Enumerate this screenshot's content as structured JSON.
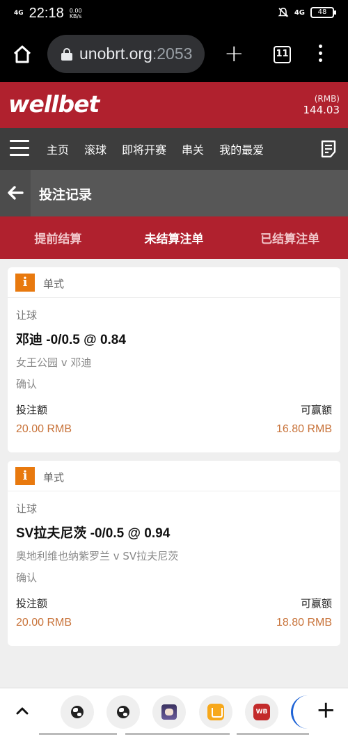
{
  "status_bar": {
    "network": "4G",
    "time": "22:18",
    "speed_value": "0.00",
    "speed_unit": "KB/s",
    "signal": "4G",
    "battery": "48"
  },
  "browser": {
    "url_host": "unobrt.org",
    "url_port": ":2053",
    "tab_count": "11"
  },
  "header": {
    "logo": "wellbet",
    "currency": "(RMB)",
    "balance": "144.03"
  },
  "nav": {
    "items": [
      "主页",
      "滚球",
      "即将开赛",
      "串关",
      "我的最爱"
    ]
  },
  "page": {
    "title": "投注记录"
  },
  "tabs": [
    {
      "label": "提前结算",
      "active": false
    },
    {
      "label": "未结算注单",
      "active": true
    },
    {
      "label": "已结算注单",
      "active": false
    }
  ],
  "bets": [
    {
      "icon": "i",
      "type": "单式",
      "market": "让球",
      "selection": "邓迪 -0/0.5 @ 0.84",
      "event": "女王公园 v 邓迪",
      "status": "确认",
      "stake_label": "投注额",
      "win_label": "可赢额",
      "stake": "20.00 RMB",
      "to_win": "16.80 RMB"
    },
    {
      "icon": "i",
      "type": "单式",
      "market": "让球",
      "selection": "SV拉夫尼茨 -0/0.5 @ 0.94",
      "event": "奥地利维也纳紫罗兰 v SV拉夫尼茨",
      "status": "确认",
      "stake_label": "投注额",
      "win_label": "可赢额",
      "stake": "20.00 RMB",
      "to_win": "18.80 RMB"
    }
  ],
  "bottom_bar": {
    "red_app_text": "WB"
  },
  "colors": {
    "brand_red": "#b0212e",
    "nav_dark": "#3d3d3d",
    "accent_orange": "#e8790e",
    "amount_orange": "#c8733a"
  }
}
